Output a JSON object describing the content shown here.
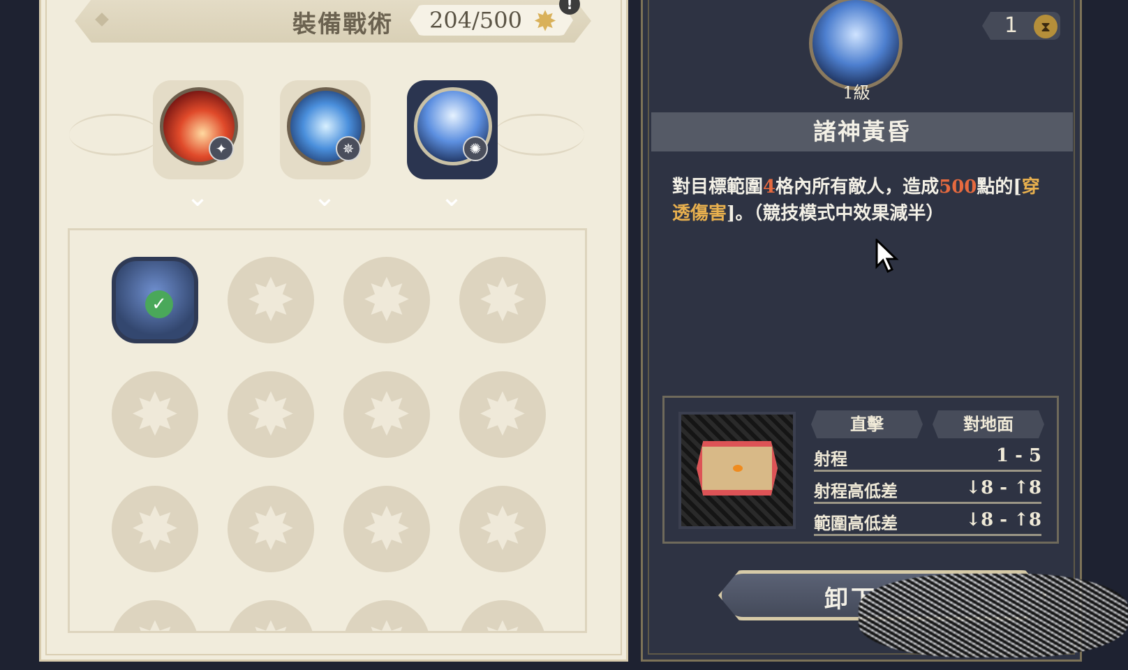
{
  "left_panel": {
    "header": {
      "title": "裝備戰術",
      "counter": "204/500",
      "alert": "!"
    },
    "tactic_slots": [
      {
        "name": "fire-burst-skill",
        "badge": "✦"
      },
      {
        "name": "dash-run-skill",
        "badge": "✵"
      },
      {
        "name": "light-rain-skill",
        "badge": "✺"
      }
    ],
    "grid": {
      "equipped_index": 0,
      "rows": 4,
      "cols": 4
    }
  },
  "right_panel": {
    "emblem": {
      "level": "1級"
    },
    "turn": {
      "value": "1"
    },
    "skill": {
      "name": "諸神黃昏",
      "desc_parts": [
        {
          "text": "對目標範圍",
          "style": "normal"
        },
        {
          "text": "4",
          "style": "red"
        },
        {
          "text": "格內所有敵人，造成",
          "style": "normal"
        },
        {
          "text": "500",
          "style": "red"
        },
        {
          "text": "點的[",
          "style": "normal"
        },
        {
          "text": "穿透傷害",
          "style": "gold"
        },
        {
          "text": "]。（競技模式中效果減半）",
          "style": "normal"
        }
      ]
    },
    "stats": {
      "tags": [
        "直擊",
        "對地面"
      ],
      "rows": [
        {
          "label": "射程",
          "value": "1 - 5"
        },
        {
          "label": "射程高低差",
          "value": "↓8 - ↑8"
        },
        {
          "label": "範圍高低差",
          "value": "↓8 - ↑8"
        }
      ]
    },
    "unequip_label": "卸下"
  },
  "colors": {
    "panel_light": "#f1ecdc",
    "panel_dark": "#2e3343",
    "highlight_red": "#e66a3f",
    "highlight_gold": "#e8b04e"
  }
}
